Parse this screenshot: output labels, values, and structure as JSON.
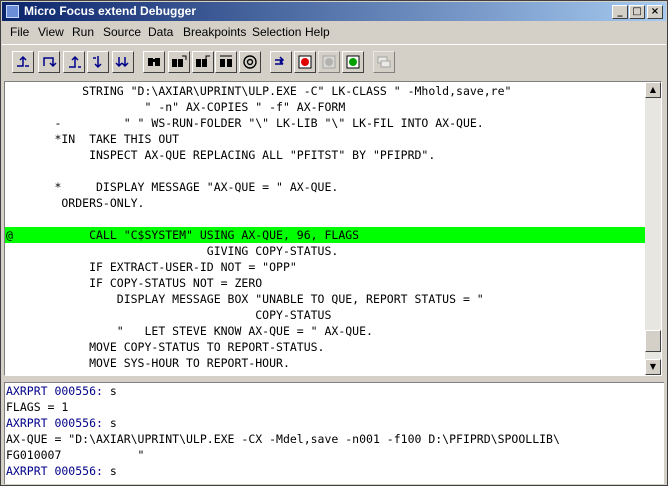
{
  "window": {
    "title": "Micro Focus extend Debugger",
    "minimize": "_",
    "maximize": "□",
    "close": "×"
  },
  "menu": [
    "File",
    "View",
    "Run",
    "Source",
    "Data",
    "Breakpoints",
    "Selection",
    "Help"
  ],
  "toolbar": [
    {
      "name": "step-icon"
    },
    {
      "name": "step-over-icon"
    },
    {
      "name": "step-out-icon"
    },
    {
      "name": "step-into-icon"
    },
    {
      "name": "step-back-icon"
    },
    {
      "name": "find-icon"
    },
    {
      "name": "find-next-icon"
    },
    {
      "name": "find-previous-icon"
    },
    {
      "name": "find-all-icon"
    },
    {
      "name": "at-sign-icon"
    },
    {
      "name": "run-to-cursor-icon"
    },
    {
      "name": "set-breakpoint-icon"
    },
    {
      "name": "clear-breakpoint-icon"
    },
    {
      "name": "breakpoint-list-icon"
    },
    {
      "name": "window-tile-icon"
    }
  ],
  "source": {
    "lines": [
      "           STRING \"D:\\AXIAR\\UPRINT\\ULP.EXE -C\" LK-CLASS \" -Mhold,save,re\"",
      "                    \" -n\" AX-COPIES \" -f\" AX-FORM",
      "       -         \" \" WS-RUN-FOLDER \"\\\" LK-LIB \"\\\" LK-FIL INTO AX-QUE.",
      "       *IN  TAKE THIS OUT",
      "            INSPECT AX-QUE REPLACING ALL \"PFITST\" BY \"PFIPRD\".",
      "",
      "       *     DISPLAY MESSAGE \"AX-QUE = \" AX-QUE.",
      "        ORDERS-ONLY.",
      "",
      "@           CALL \"C$SYSTEM\" USING AX-QUE, 96, FLAGS",
      "                             GIVING COPY-STATUS.",
      "            IF EXTRACT-USER-ID NOT = \"OPP\"",
      "            IF COPY-STATUS NOT = ZERO",
      "                DISPLAY MESSAGE BOX \"UNABLE TO QUE, REPORT STATUS = \"",
      "                                    COPY-STATUS",
      "                \"   LET STEVE KNOW AX-QUE = \" AX-QUE.",
      "            MOVE COPY-STATUS TO REPORT-STATUS.",
      "            MOVE SYS-HOUR TO REPORT-HOUR."
    ],
    "current_line_index": 9,
    "current_line_color": "#00ff00"
  },
  "scrollbar": {
    "up": "▲",
    "down": "▼"
  },
  "console": {
    "lines": [
      {
        "prompt": "AXRPRT 000556:",
        "text": " s"
      },
      {
        "prompt": "",
        "text": "FLAGS = 1"
      },
      {
        "prompt": "AXRPRT 000556:",
        "text": " s"
      },
      {
        "prompt": "",
        "text": "AX-QUE = \"D:\\AXIAR\\UPRINT\\ULP.EXE -CX -Mdel,save -n001 -f100 D:\\PFIPRD\\SPOOLLIB\\"
      },
      {
        "prompt": "",
        "text": "FG010007           \""
      },
      {
        "prompt": "AXRPRT 000556:",
        "text": " s"
      }
    ]
  }
}
